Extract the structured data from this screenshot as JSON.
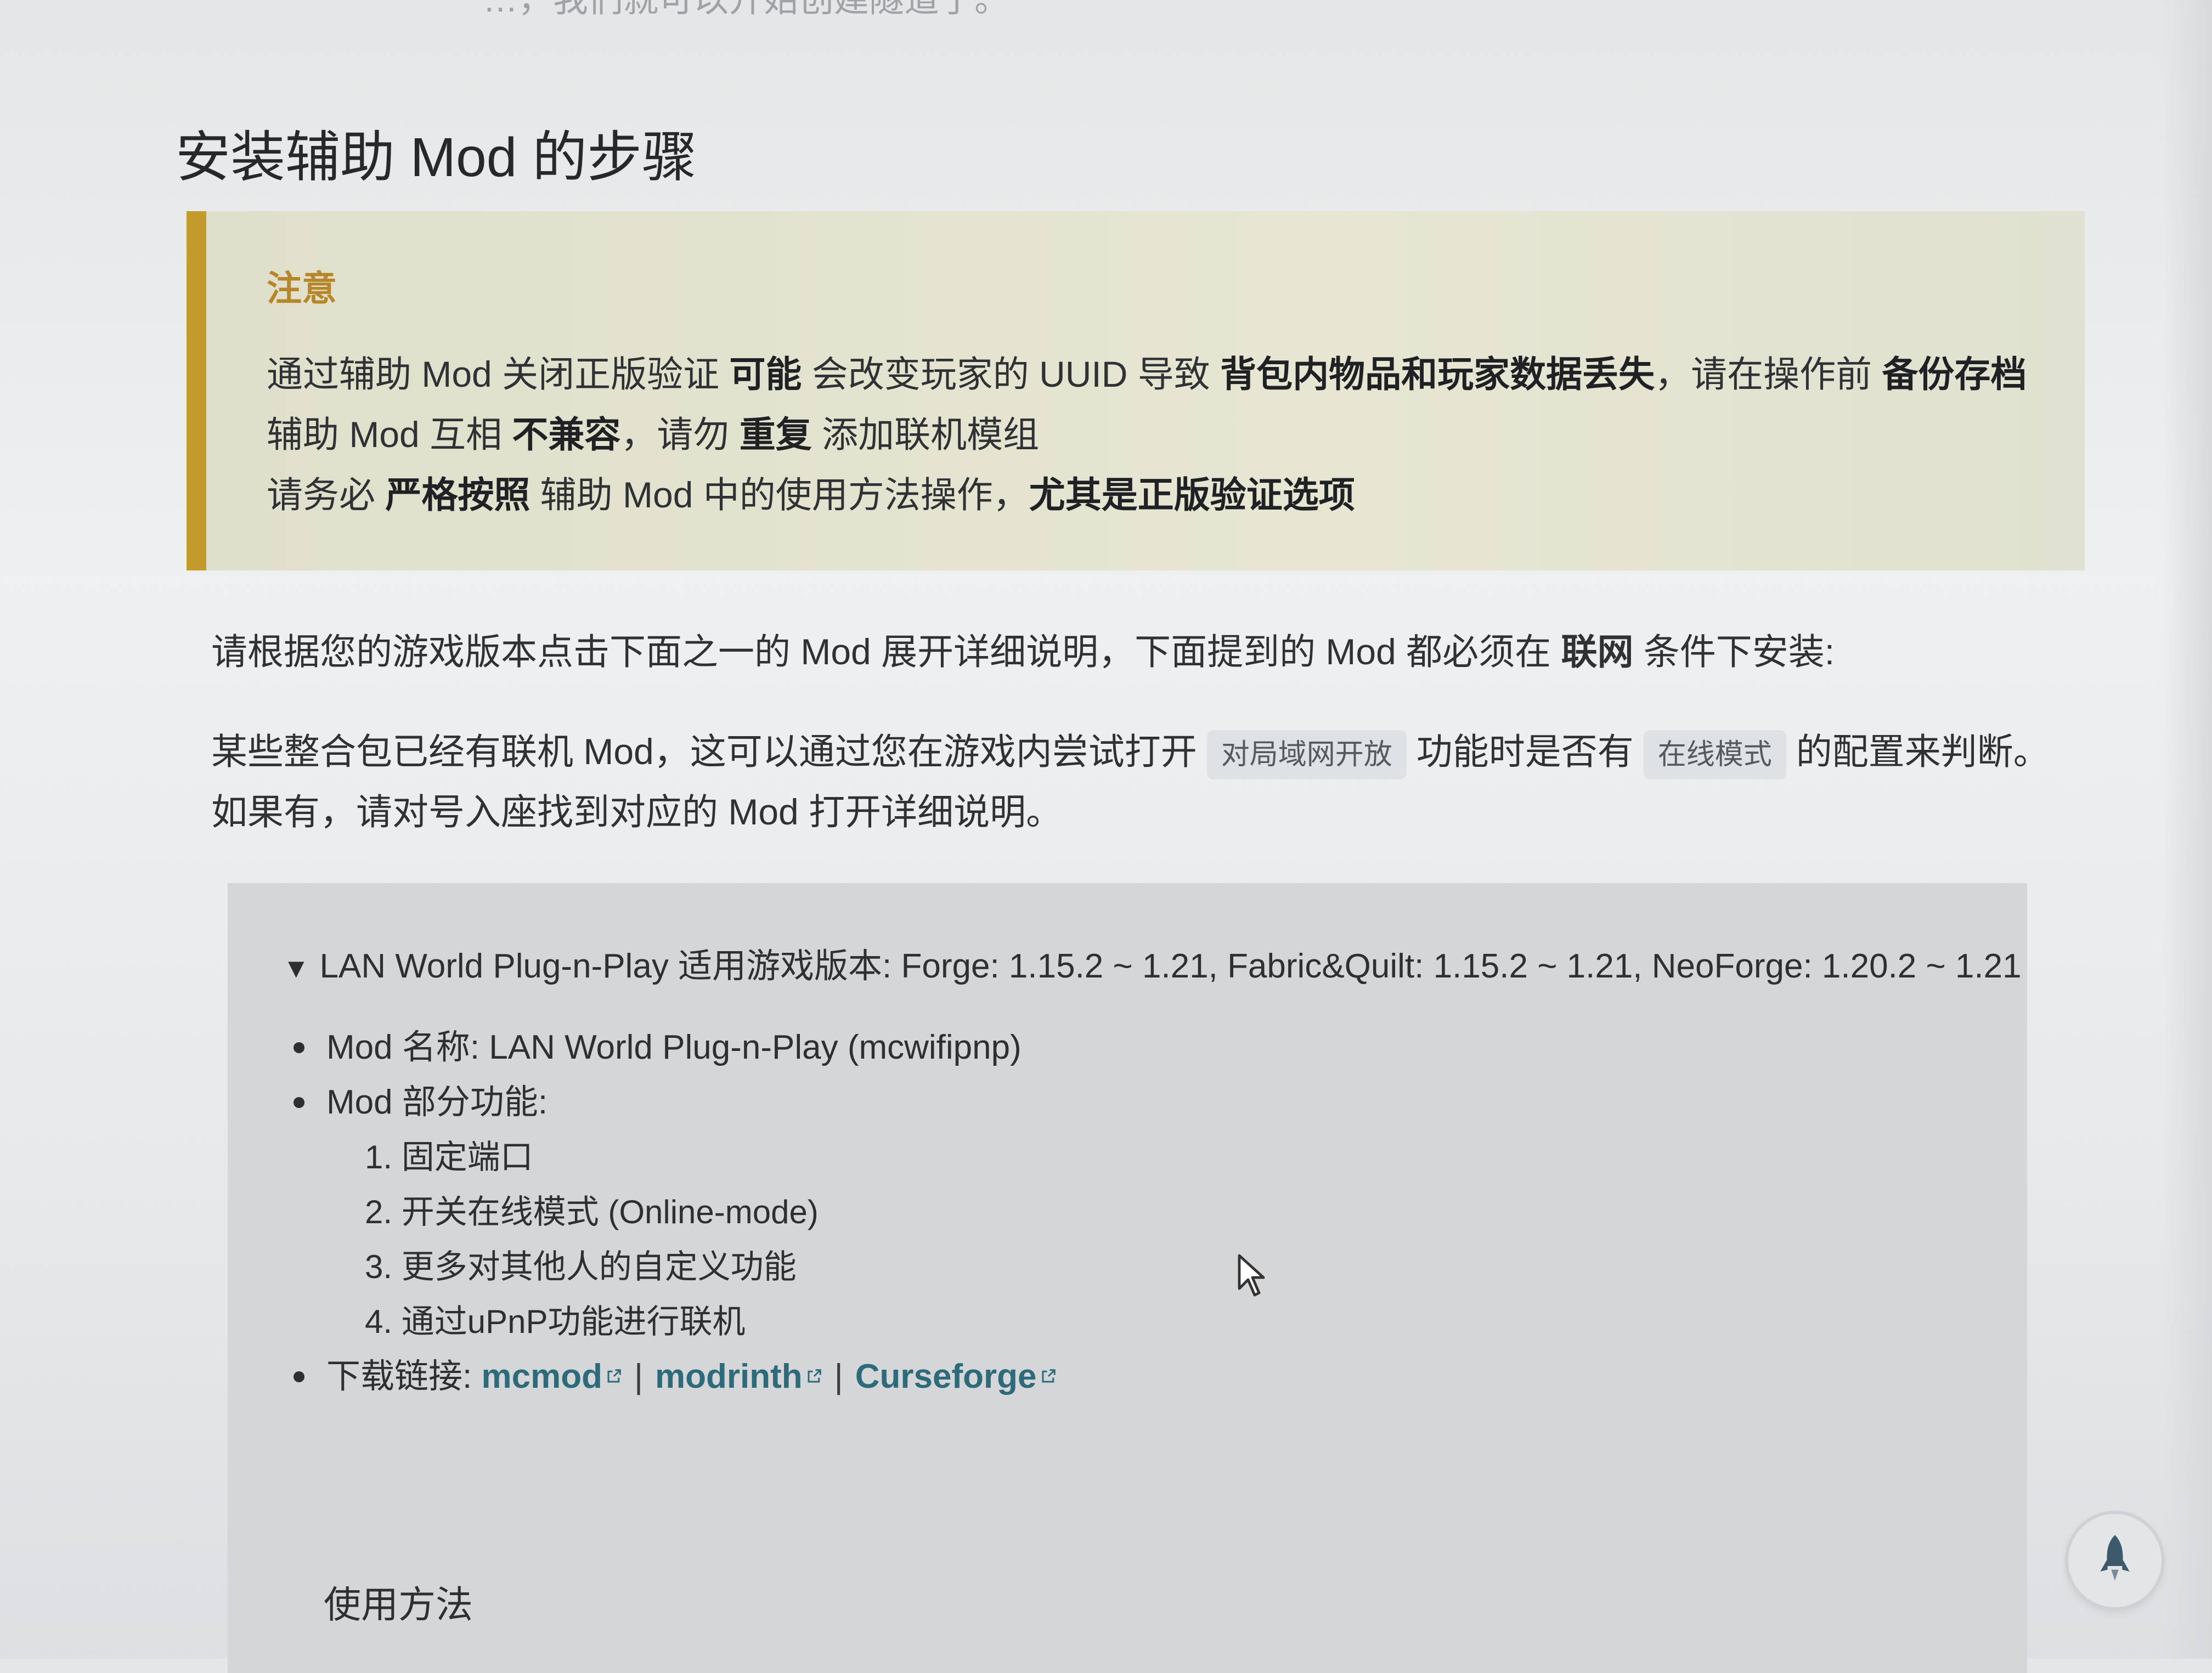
{
  "page": {
    "top_fragment": "…，我们就可以开始创建隧道了。",
    "heading": "安装辅助 Mod 的步骤"
  },
  "notice": {
    "title": "注意",
    "line1": {
      "t1": "通过辅助 Mod 关闭正版验证 ",
      "b1": "可能",
      "t2": " 会改变玩家的 UUID 导致 ",
      "b2": "背包内物品和玩家数据丢失",
      "t3": "，请在操作前 ",
      "b3": "备份存档"
    },
    "line2": {
      "t1": "辅助 Mod 互相 ",
      "b1": "不兼容",
      "t2": "，请勿 ",
      "b2": "重复",
      "t3": " 添加联机模组"
    },
    "line3": {
      "t1": "请务必 ",
      "b1": "严格按照",
      "t2": " 辅助 Mod 中的使用方法操作，",
      "b2": "尤其是正版验证选项"
    }
  },
  "intro": {
    "p1_text": "请根据您的游戏版本点击下面之一的 Mod 展开详细说明，下面提到的 Mod 都必须在 ",
    "p1_bold": "联网",
    "p1_end": " 条件下安装:",
    "p2_a": "某些整合包已经有联机 Mod，这可以通过您在游戏内尝试打开",
    "code1": "对局域网开放",
    "p2_b": "功能时是否有",
    "code2": "在线模式",
    "p2_c": "的配置来判断。",
    "p2_d": "如果有，请对号入座找到对应的 Mod 打开详细说明。"
  },
  "details": {
    "summary": "LAN World Plug-n-Play 适用游戏版本: Forge: 1.15.2 ~ 1.21, Fabric&Quilt: 1.15.2 ~ 1.21, NeoForge: 1.20.2 ~ 1.21",
    "mod_name": "Mod 名称: LAN World Plug-n-Play (mcwifipnp)",
    "features_label": "Mod 部分功能:",
    "features": [
      "1. 固定端口",
      "2. 开关在线模式 (Online-mode)",
      "3. 更多对其他人的自定义功能",
      "4. 通过uPnP功能进行联机"
    ],
    "download_label": "下载链接: ",
    "links": [
      "mcmod",
      "modrinth",
      "Curseforge"
    ],
    "link_separator": "|",
    "usage_heading": "使用方法"
  },
  "colors": {
    "accent": "#c29b2a",
    "notice_title": "#b8862a",
    "link": "#2d6a7a"
  },
  "icons": [
    "triangle-down-icon",
    "external-link-icon",
    "mouse-cursor-icon",
    "rocket-icon"
  ]
}
